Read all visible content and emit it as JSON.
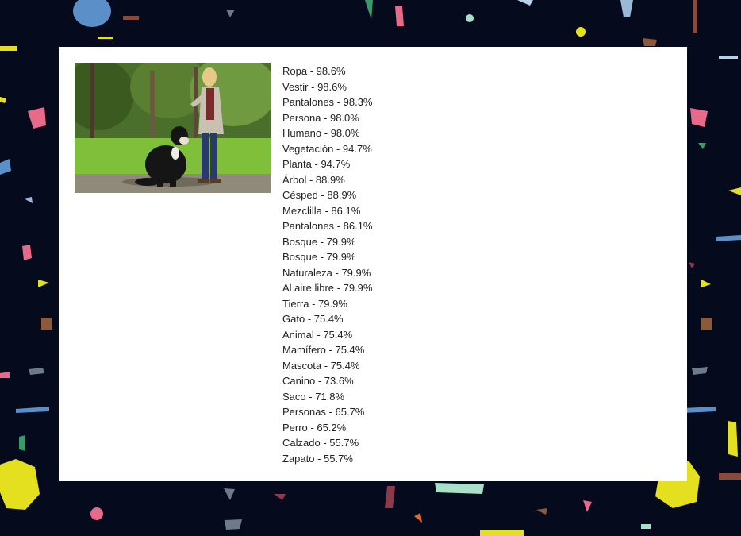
{
  "image": {
    "alt_icon": "photo-woman-with-dog-icon"
  },
  "labels": [
    {
      "name": "Ropa",
      "score": "98.6%"
    },
    {
      "name": "Vestir",
      "score": "98.6%"
    },
    {
      "name": "Pantalones",
      "score": "98.3%"
    },
    {
      "name": "Persona",
      "score": "98.0%"
    },
    {
      "name": "Humano",
      "score": "98.0%"
    },
    {
      "name": "Vegetación",
      "score": "94.7%"
    },
    {
      "name": "Planta",
      "score": "94.7%"
    },
    {
      "name": "Árbol",
      "score": "88.9%"
    },
    {
      "name": "Césped",
      "score": "88.9%"
    },
    {
      "name": "Mezclilla",
      "score": "86.1%"
    },
    {
      "name": "Pantalones",
      "score": "86.1%"
    },
    {
      "name": "Bosque",
      "score": "79.9%"
    },
    {
      "name": "Bosque",
      "score": "79.9%"
    },
    {
      "name": "Naturaleza",
      "score": "79.9%"
    },
    {
      "name": "Al aire libre",
      "score": "79.9%"
    },
    {
      "name": "Tierra",
      "score": "79.9%"
    },
    {
      "name": "Gato",
      "score": "75.4%"
    },
    {
      "name": "Animal",
      "score": "75.4%"
    },
    {
      "name": "Mamífero",
      "score": "75.4%"
    },
    {
      "name": "Mascota",
      "score": "75.4%"
    },
    {
      "name": "Canino",
      "score": "73.6%"
    },
    {
      "name": "Saco",
      "score": "71.8%"
    },
    {
      "name": "Personas",
      "score": "65.7%"
    },
    {
      "name": "Perro",
      "score": "65.2%"
    },
    {
      "name": "Calzado",
      "score": "55.7%"
    },
    {
      "name": "Zapato",
      "score": "55.7%"
    }
  ],
  "colors": {
    "background": "#050a1c",
    "panel": "#ffffff",
    "text": "#222222"
  }
}
